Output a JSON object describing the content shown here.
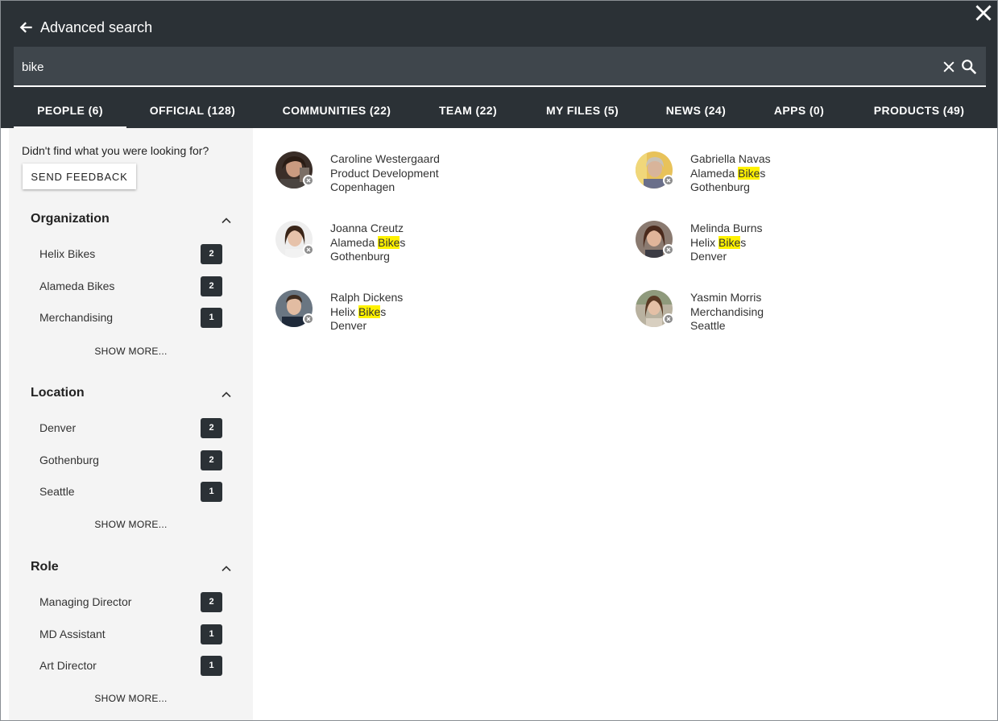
{
  "header": {
    "title": "Advanced search",
    "search_value": "bike",
    "tabs": [
      {
        "label": "PEOPLE (6)"
      },
      {
        "label": "OFFICIAL (128)"
      },
      {
        "label": "COMMUNITIES (22)"
      },
      {
        "label": "TEAM (22)"
      },
      {
        "label": "MY FILES (5)"
      },
      {
        "label": "NEWS (24)"
      },
      {
        "label": "APPS (0)"
      },
      {
        "label": "PRODUCTS (49)"
      }
    ],
    "active_tab": "PEOPLE (6)"
  },
  "sidebar": {
    "feedback_text": "Didn't find what you were looking for?",
    "feedback_button": "SEND FEEDBACK",
    "facets": [
      {
        "title": "Organization",
        "items": [
          {
            "label": "Helix Bikes",
            "count": "2"
          },
          {
            "label": "Alameda Bikes",
            "count": "2"
          },
          {
            "label": "Merchandising",
            "count": "1"
          }
        ],
        "show_more": "SHOW MORE..."
      },
      {
        "title": "Location",
        "items": [
          {
            "label": "Denver",
            "count": "2"
          },
          {
            "label": "Gothenburg",
            "count": "2"
          },
          {
            "label": "Seattle",
            "count": "1"
          }
        ],
        "show_more": "SHOW MORE..."
      },
      {
        "title": "Role",
        "items": [
          {
            "label": "Managing Director",
            "count": "2"
          },
          {
            "label": "MD Assistant",
            "count": "1"
          },
          {
            "label": "Art Director",
            "count": "1"
          }
        ],
        "show_more": "SHOW MORE..."
      }
    ]
  },
  "results": {
    "people": [
      {
        "name": "Caroline Westergaard",
        "org_pre": "Product Development",
        "org_hl": "",
        "org_post": "",
        "location": "Copenhagen"
      },
      {
        "name": "Gabriella Navas",
        "org_pre": "Alameda ",
        "org_hl": "Bike",
        "org_post": "s",
        "location": "Gothenburg"
      },
      {
        "name": "Joanna Creutz",
        "org_pre": "Alameda ",
        "org_hl": "Bike",
        "org_post": "s",
        "location": "Gothenburg"
      },
      {
        "name": "Melinda Burns",
        "org_pre": "Helix ",
        "org_hl": "Bike",
        "org_post": "s",
        "location": "Denver"
      },
      {
        "name": "Ralph Dickens",
        "org_pre": "Helix ",
        "org_hl": "Bike",
        "org_post": "s",
        "location": "Denver"
      },
      {
        "name": "Yasmin Morris",
        "org_pre": "Merchandising",
        "org_hl": "",
        "org_post": "",
        "location": "Seattle"
      }
    ]
  },
  "colors": {
    "header_bg": "#2b3136",
    "search_bg": "#3f464c",
    "sidebar_bg": "#f4f4f4",
    "highlight": "#fff200",
    "badge_bg": "#2b3136",
    "status_offline": "#8c8c8c"
  },
  "icons": {
    "close": "close-icon",
    "back": "arrow-left-icon",
    "clear": "clear-icon",
    "search": "search-icon",
    "collapse": "chevron-up-icon",
    "status": "offline-status-icon"
  }
}
